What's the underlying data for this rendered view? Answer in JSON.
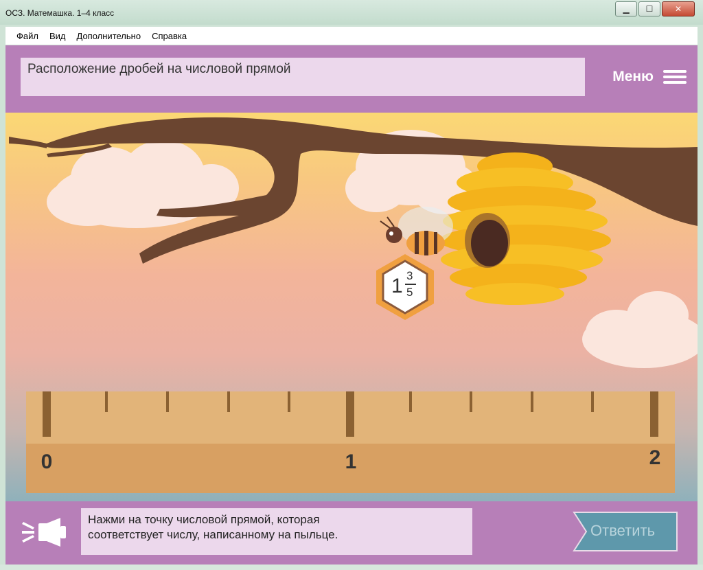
{
  "window": {
    "title": "ОСЗ. Матемашка. 1–4 класс"
  },
  "menubar": {
    "items": [
      "Файл",
      "Вид",
      "Дополнительно",
      "Справка"
    ]
  },
  "header": {
    "title": "Расположение дробей на числовой прямой",
    "menu_label": "Меню"
  },
  "scene": {
    "fraction": {
      "whole": "1",
      "numerator": "3",
      "denominator": "5"
    },
    "number_line": {
      "labels": [
        "0",
        "1",
        "2"
      ],
      "divisions_per_unit": 5
    }
  },
  "footer": {
    "instruction_line1": "Нажми на точку числовой прямой, которая",
    "instruction_line2": "соответствует числу, написанному на пыльце.",
    "answer_label": "Ответить"
  },
  "colors": {
    "accent": "#b77fb8",
    "panel": "#ecd8ec",
    "answer_button": "#5e98ab"
  }
}
